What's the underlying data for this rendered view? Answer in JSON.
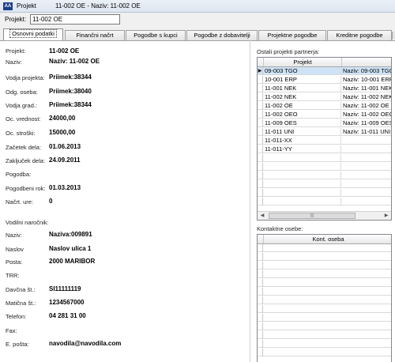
{
  "window": {
    "app_icon_text": "AA",
    "title": "Projekt",
    "subtitle": "11-002 OE      - Naziv: 11-002 OE"
  },
  "project_selector": {
    "label": "Projekt:",
    "value": "11-002 OE"
  },
  "tabs": [
    {
      "label": "Osnovni podatki",
      "active": true
    },
    {
      "label": "Finančni načrt",
      "active": false
    },
    {
      "label": "Pogodbe s kupci",
      "active": false
    },
    {
      "label": "Pogodbe z dobavitelji",
      "active": false
    },
    {
      "label": "Projektne pogodbe",
      "active": false
    },
    {
      "label": "Kreditne pogodbe",
      "active": false
    }
  ],
  "basic": {
    "fields": [
      {
        "label": "Projekt:",
        "value": "11-002 OE"
      },
      {
        "label": "Naziv:",
        "value": "Naziv: 11-002 OE"
      },
      {
        "label": "Vodja projekta:",
        "value": "Priimek:38344"
      },
      {
        "label": "Odg. oseba:",
        "value": "Priimek:38040"
      },
      {
        "label": "Vodja grad.:",
        "value": "Priimek:38344"
      },
      {
        "label": "Oc. vrednost:",
        "value": "24000,00"
      },
      {
        "label": "Oc. stroški:",
        "value": "15000,00"
      },
      {
        "label": "Začetek dela:",
        "value": "01.06.2013"
      },
      {
        "label": "Zaključek dela:",
        "value": "24.09.2011"
      },
      {
        "label": "Pogodba:",
        "value": ""
      },
      {
        "label": "Pogodbeni rok:",
        "value": "01.03.2013"
      },
      {
        "label": "Načrt. ure:",
        "value": "0"
      }
    ]
  },
  "client": {
    "section_title": "Vodilni naročnik:",
    "fields": [
      {
        "label": "Naziv:",
        "value": "Naziva:009891"
      },
      {
        "label": "Naslov",
        "value": "Naslov ulica 1"
      },
      {
        "label": "Posta:",
        "value": "2000 MARIBOR"
      },
      {
        "label": "TRR:",
        "value": ""
      },
      {
        "label": "Davčna št.:",
        "value": "SI11111119"
      },
      {
        "label": "Matična št.:",
        "value": "1234567000"
      },
      {
        "label": "Telefon:",
        "value": "04 281 31 00"
      },
      {
        "label": "Fax:",
        "value": ""
      },
      {
        "label": "E. pošta:",
        "value": "navodila@navodila.com"
      }
    ]
  },
  "partner_projects": {
    "title": "Ostali projekti partnerja:",
    "columns": [
      "Projekt",
      ""
    ],
    "rows": [
      {
        "code": "09-003 TGO",
        "name": "Naziv: 09-003 TGO",
        "selected": true,
        "marker": "▶"
      },
      {
        "code": "10-001 ERP",
        "name": "Naziv: 10-001 ERP"
      },
      {
        "code": "11-001 NEK",
        "name": "Naziv: 11-001 NEK"
      },
      {
        "code": "11-002 NEK",
        "name": "Naziv: 11-002 NEK"
      },
      {
        "code": "11-002 OE",
        "name": "Naziv: 11-002 OE"
      },
      {
        "code": "11-002 OEO",
        "name": "Naziv: 11-002 OEO"
      },
      {
        "code": "11-009 OES",
        "name": "Naziv: 11-009 OES"
      },
      {
        "code": "11-011 UNI",
        "name": "Naziv: 11-011 UNI"
      },
      {
        "code": "11-011-XX",
        "name": ""
      },
      {
        "code": "11-011-YY",
        "name": ""
      }
    ],
    "scroll_left": "◀",
    "scroll_right": "▶",
    "scroll_grip": "|||"
  },
  "contacts": {
    "title": "Kontaktne osebe:",
    "column": "Kont. oseba"
  }
}
